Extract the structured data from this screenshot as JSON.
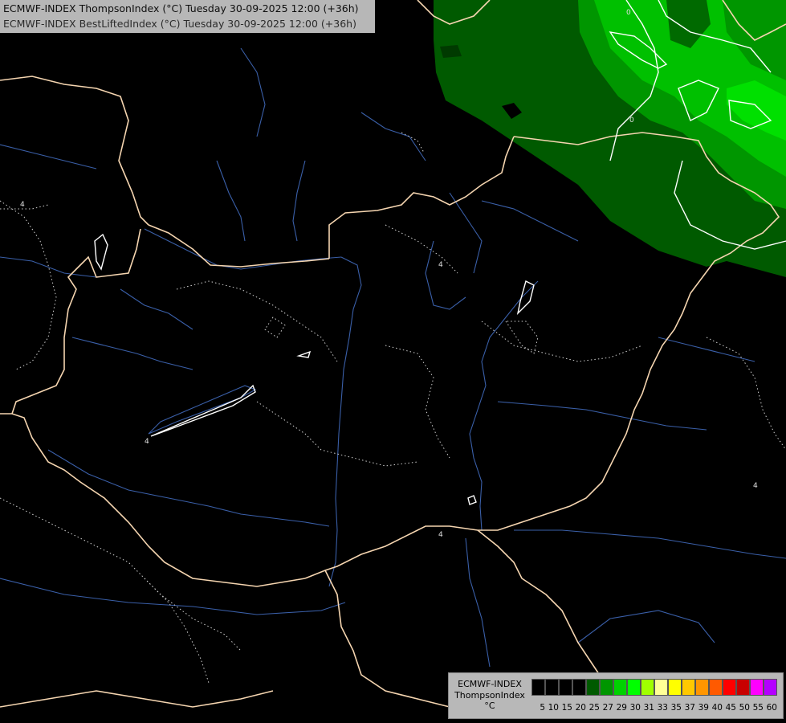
{
  "header": {
    "line1": "ECMWF-INDEX ThompsonIndex (°C) Tuesday 30-09-2025 12:00 (+36h)",
    "line2": "ECMWF-INDEX BestLiftedIndex (°C) Tuesday 30-09-2025 12:00 (+36h)"
  },
  "legend": {
    "model": "ECMWF-INDEX",
    "parameter": "ThompsonIndex",
    "unit": "°C",
    "scale": [
      {
        "value": "5",
        "color": "#000000"
      },
      {
        "value": "10",
        "color": "#000000"
      },
      {
        "value": "15",
        "color": "#000000"
      },
      {
        "value": "20",
        "color": "#000000"
      },
      {
        "value": "25",
        "color": "#005a00"
      },
      {
        "value": "27",
        "color": "#009600"
      },
      {
        "value": "29",
        "color": "#00d200"
      },
      {
        "value": "30",
        "color": "#00ff00"
      },
      {
        "value": "31",
        "color": "#a0ff00"
      },
      {
        "value": "33",
        "color": "#ffff96"
      },
      {
        "value": "35",
        "color": "#ffff00"
      },
      {
        "value": "37",
        "color": "#ffc800"
      },
      {
        "value": "39",
        "color": "#ff9600"
      },
      {
        "value": "40",
        "color": "#ff5a00"
      },
      {
        "value": "45",
        "color": "#ff0000"
      },
      {
        "value": "50",
        "color": "#c80000"
      },
      {
        "value": "55",
        "color": "#ff00ff"
      },
      {
        "value": "60",
        "color": "#b400ff"
      }
    ]
  },
  "contour_labels": [
    "4",
    "4",
    "4",
    "4",
    "4",
    "0",
    "0"
  ],
  "colors": {
    "border": "#f5d5b0",
    "river": "#3a5fa8",
    "contour_dotted": "#cfcfcf",
    "contour_solid": "#ffffff"
  }
}
